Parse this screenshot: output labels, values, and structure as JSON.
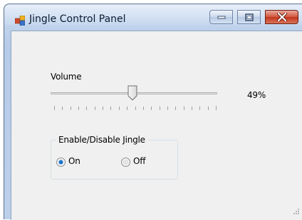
{
  "window": {
    "title": "Jingle Control Panel",
    "icon": "app-window-icon"
  },
  "controls": {
    "minimize_icon": "minimize-icon",
    "maximize_icon": "maximize-icon",
    "close_icon": "close-icon"
  },
  "volume": {
    "label": "Volume",
    "value_text": "49%",
    "value": 49,
    "min": 0,
    "max": 100
  },
  "jingle_group": {
    "title": "Enable/Disable Jingle",
    "options": [
      {
        "label": "On",
        "selected": true
      },
      {
        "label": "Off",
        "selected": false
      }
    ]
  },
  "colors": {
    "close_button": "#c0341c",
    "radio_selected": "#1a74c9"
  }
}
